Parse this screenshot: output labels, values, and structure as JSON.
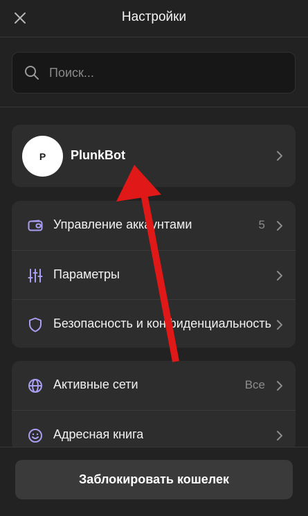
{
  "header": {
    "title": "Настройки",
    "close_icon": "close-icon"
  },
  "search": {
    "placeholder": "Поиск...",
    "value": "",
    "icon": "search-icon"
  },
  "profile": {
    "avatar_letter": "P",
    "name": "PlunkBot"
  },
  "groups": [
    {
      "items": [
        {
          "icon": "wallet-icon",
          "label": "Управление аккаунтами",
          "meta": "5"
        },
        {
          "icon": "sliders-icon",
          "label": "Параметры",
          "meta": ""
        },
        {
          "icon": "shield-icon",
          "label": "Безопасность и конфиденциальность",
          "meta": ""
        }
      ]
    },
    {
      "items": [
        {
          "icon": "globe-icon",
          "label": "Активные сети",
          "meta": "Все"
        },
        {
          "icon": "smiley-icon",
          "label": "Адресная книга",
          "meta": ""
        }
      ]
    }
  ],
  "footer": {
    "lock_label": "Заблокировать кошелек"
  },
  "colors": {
    "background": "#222222",
    "card": "#2d2d2d",
    "accent_icon": "#a99ff2",
    "annotation_arrow": "#e01818"
  }
}
